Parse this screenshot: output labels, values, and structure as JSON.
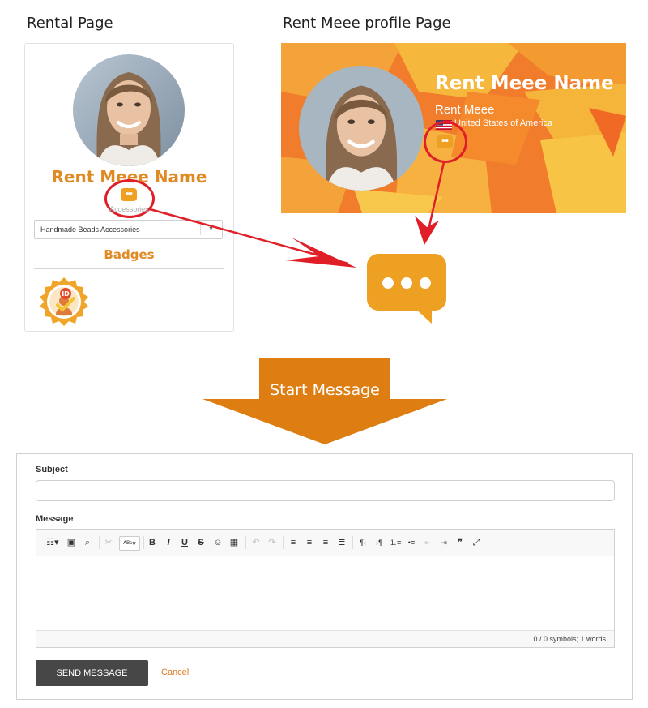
{
  "sections": {
    "rental_title": "Rental Page",
    "profile_title": "Rent Meee profile Page"
  },
  "rental_card": {
    "name": "Rent Meee Name",
    "category": "Accessories",
    "select_value": "Handmade Beads Accessories",
    "badges_title": "Badges"
  },
  "profile": {
    "name": "Rent Meee Name",
    "subtitle": "Rent Meee",
    "country": "United States of America"
  },
  "start_message": "Start Message",
  "form": {
    "subject_label": "Subject",
    "subject_value": "",
    "message_label": "Message",
    "status": "0 / 0 symbols; 1 words",
    "send_label": "SEND MESSAGE",
    "cancel_label": "Cancel"
  },
  "colors": {
    "accent": "#e08a24",
    "callout_red": "#e01e28",
    "bubble": "#eea022",
    "arrow": "#de7e12",
    "send_button": "#474747"
  },
  "icons": {
    "message": "speech-bubble-dots-icon",
    "badge": "id-verified-badge-icon",
    "flag": "us-flag-icon"
  }
}
